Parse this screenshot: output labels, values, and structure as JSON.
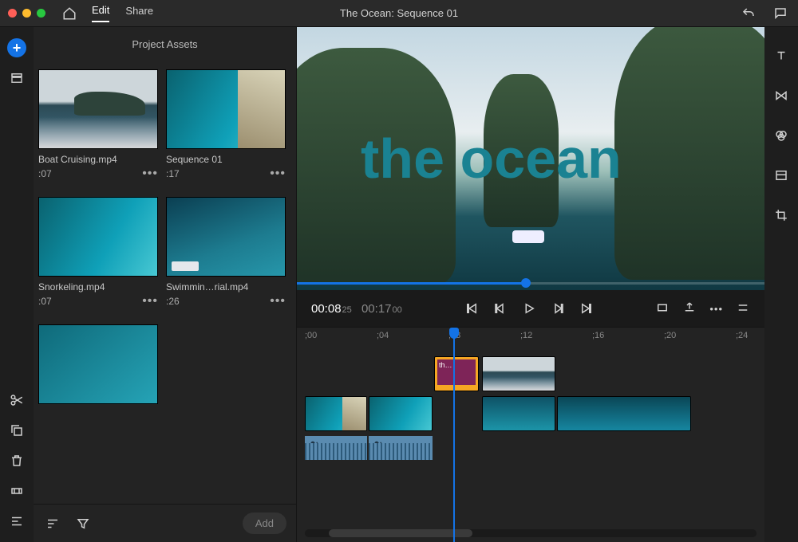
{
  "titlebar": {
    "tabs": {
      "edit": "Edit",
      "share": "Share"
    },
    "title": "The Ocean: Sequence 01"
  },
  "panel": {
    "title": "Project Assets",
    "add_btn": "Add",
    "assets": [
      {
        "name": "Boat Cruising.mp4",
        "duration": ":07"
      },
      {
        "name": "Sequence 01",
        "duration": ":17"
      },
      {
        "name": "Snorkeling.mp4",
        "duration": ":07"
      },
      {
        "name": "Swimmin…rial.mp4",
        "duration": ":26"
      }
    ]
  },
  "preview": {
    "overlay": "the ocean"
  },
  "playbar": {
    "current": "00:08",
    "current_frames": "25",
    "duration": "00:17",
    "duration_frames": "00"
  },
  "ruler": [
    ";00",
    ";04",
    ";08",
    ";12",
    ";16",
    ";20",
    ";24"
  ],
  "clips": {
    "title_label": "th…"
  }
}
